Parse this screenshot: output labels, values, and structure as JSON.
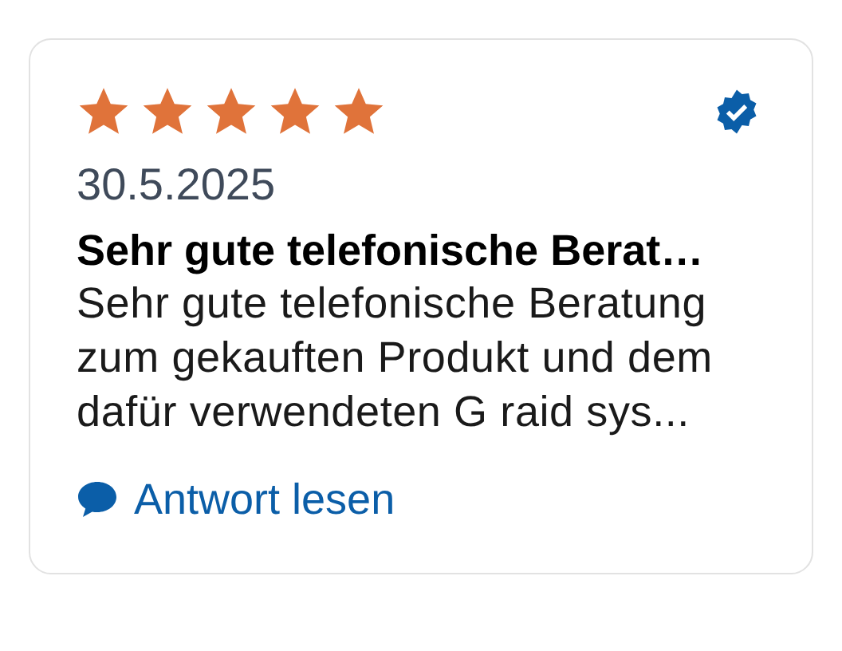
{
  "review": {
    "stars": 5,
    "verified": true,
    "date": "30.5.2025",
    "title": "Sehr gute telefonische Berat…",
    "body": "Sehr gute telefonische Beratung\nzum gekauften Produkt und dem\ndafür verwendeten G raid sys...",
    "link": "Antwort lesen"
  }
}
